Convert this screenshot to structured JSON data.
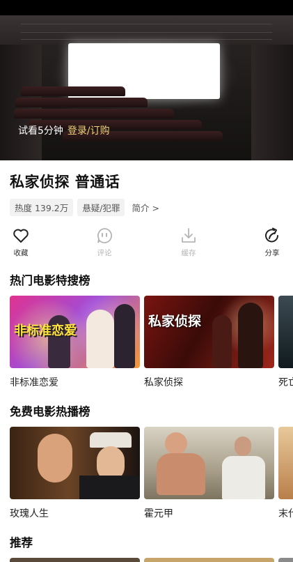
{
  "player": {
    "trial_text": "试看5分钟",
    "login_text": "登录/订购"
  },
  "movie": {
    "title": "私家侦探 普通话",
    "heat": "热度 139.2万",
    "genre": "悬疑/犯罪",
    "intro": "简介 >"
  },
  "actions": [
    {
      "label": "收藏",
      "icon": "heart-icon",
      "enabled": true
    },
    {
      "label": "评论",
      "icon": "comment-icon",
      "enabled": false
    },
    {
      "label": "缓存",
      "icon": "download-icon",
      "enabled": false
    },
    {
      "label": "分享",
      "icon": "share-icon",
      "enabled": true
    }
  ],
  "sections": [
    {
      "title": "热门电影特搜榜",
      "items": [
        {
          "name": "非标准恋爱",
          "poster_text": "非标准恋爱"
        },
        {
          "name": "私家侦探",
          "poster_text": "私家侦探"
        },
        {
          "name": "死亡"
        }
      ]
    },
    {
      "title": "免费电影热播榜",
      "items": [
        {
          "name": "玫瑰人生"
        },
        {
          "name": "霍元甲"
        },
        {
          "name": "末代"
        }
      ]
    },
    {
      "title": "推荐",
      "items": []
    }
  ],
  "colors": {
    "login": "#f3d27a",
    "disabled": "#b5b5b5"
  }
}
